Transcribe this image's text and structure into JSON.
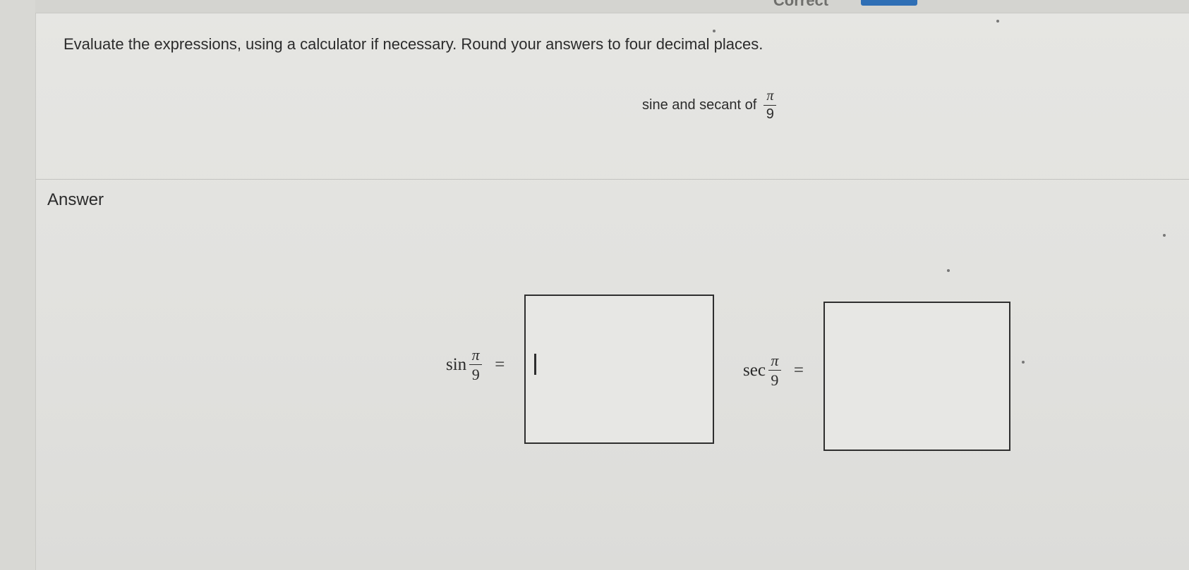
{
  "header": {
    "status_label": "Correct"
  },
  "question": {
    "instructions": "Evaluate the expressions, using a calculator if necessary. Round your answers to four decimal places.",
    "prompt_text": "sine and secant of",
    "prompt_fraction": {
      "numerator": "π",
      "denominator": "9"
    }
  },
  "answer": {
    "label": "Answer",
    "sin_expression": {
      "function": "sin",
      "numerator": "π",
      "denominator": "9",
      "equals": "=",
      "value": ""
    },
    "sec_expression": {
      "function": "sec",
      "numerator": "π",
      "denominator": "9",
      "equals": "=",
      "value": ""
    }
  }
}
